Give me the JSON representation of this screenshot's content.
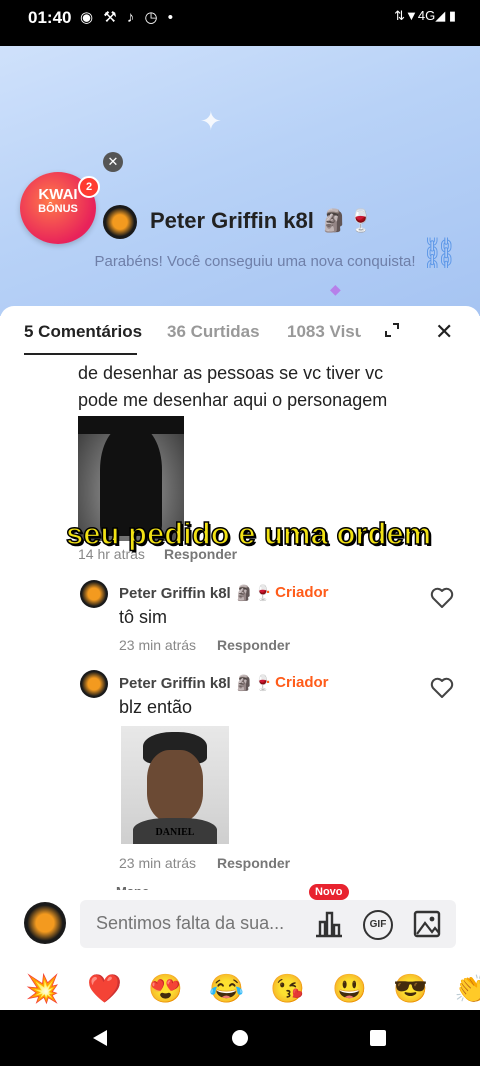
{
  "status_bar": {
    "time": "01:40",
    "icons_left": "◉ ⚒ ♪ ◷ •",
    "icons_right": "⇅▼4G◢ ▮"
  },
  "achievement": {
    "kwai_label": "KWAI",
    "bonus_label": "BÔNUS",
    "badge_count": "2",
    "user_name": "Peter Griffin k8l 🗿🍷",
    "message": "Parabéns! Você conseguiu uma nova conquista!"
  },
  "tabs": [
    {
      "label": "5 Comentários"
    },
    {
      "label": "36 Curtidas"
    },
    {
      "label": "1083 Visu"
    }
  ],
  "comments": {
    "top_comment_text_1": "de desenhar as pessoas se vc tiver vc",
    "top_comment_text_2": "pode me desenhar aqui o personagem",
    "top_comment_time": "14 hr atrás",
    "reply_label": "Responder",
    "replies": [
      {
        "user": "Peter Griffin k8l 🗿🍷",
        "badge": "· Criador",
        "text": "tô sim",
        "time": "23 min atrás",
        "reply_label": "Responder"
      },
      {
        "user": "Peter Griffin k8l 🗿🍷",
        "badge": "· Criador",
        "text": "blz então",
        "time": "23 min atrás",
        "reply_label": "Responder"
      }
    ],
    "image_caption": "DANIEL",
    "partial_next_user": "Mane..."
  },
  "overlay_subtitle": "seu pedido e uma ordem",
  "composer": {
    "placeholder": "Sentimos falta da sua...",
    "new_badge": "Novo",
    "gif_label": "GIF"
  },
  "emojis": [
    "💥",
    "❤️",
    "😍",
    "😂",
    "😘",
    "😃",
    "😎",
    "👏"
  ]
}
